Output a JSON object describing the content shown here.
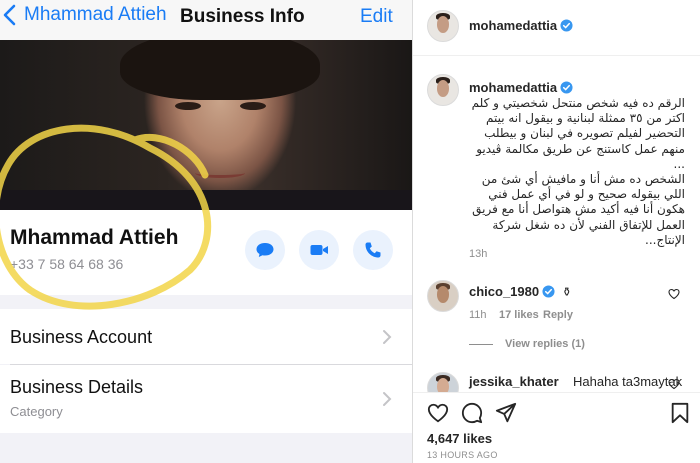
{
  "phone": {
    "nav": {
      "back_label": "Mhammad Attieh",
      "title": "Business Info",
      "edit_label": "Edit"
    },
    "contact": {
      "name": "Mhammad Attieh",
      "phone": "+33 7 58 64 68 36"
    },
    "actions": [
      {
        "icon": "message-icon"
      },
      {
        "icon": "video-icon"
      },
      {
        "icon": "phone-icon"
      }
    ],
    "rows": [
      {
        "label": "Business Account",
        "sub": ""
      },
      {
        "label": "Business Details",
        "sub": "Category"
      }
    ],
    "colors": {
      "accent": "#1a7cf5",
      "highlight": "#f2d548"
    }
  },
  "instagram": {
    "header": {
      "username": "mohamedattia"
    },
    "caption": {
      "username": "mohamedattia",
      "text": "الرقم ده فيه شخص منتحل شخصيتي و كلم اكتر من ٣٥ ممثلة لبنانية و بيقول انه بيتم التحضير لفيلم تصويره في لبنان و بيطلب منهم عمل كاستنج عن طريق مكالمة ڤيديو ...\nالشخص ده مش أنا و مافيش أي شئ من اللي بيقوله صحيح و لو في أي عمل فني هكون أنا فيه أكيد مش هتواصل أنا مع فريق العمل للإتفاق الفني لأن ده شغل شركة الإنتاج...",
      "time": "13h"
    },
    "comments": [
      {
        "username": "chico_1980",
        "time": "11h",
        "likes": "17 likes",
        "reply": "Reply",
        "view_replies": "View replies (1)"
      },
      {
        "username": "jessika_khater",
        "text": "Hahaha ta3maytak"
      }
    ],
    "likes": "4,647 likes",
    "posted": "13 HOURS AGO",
    "colors": {
      "verified": "#3897f0"
    }
  }
}
